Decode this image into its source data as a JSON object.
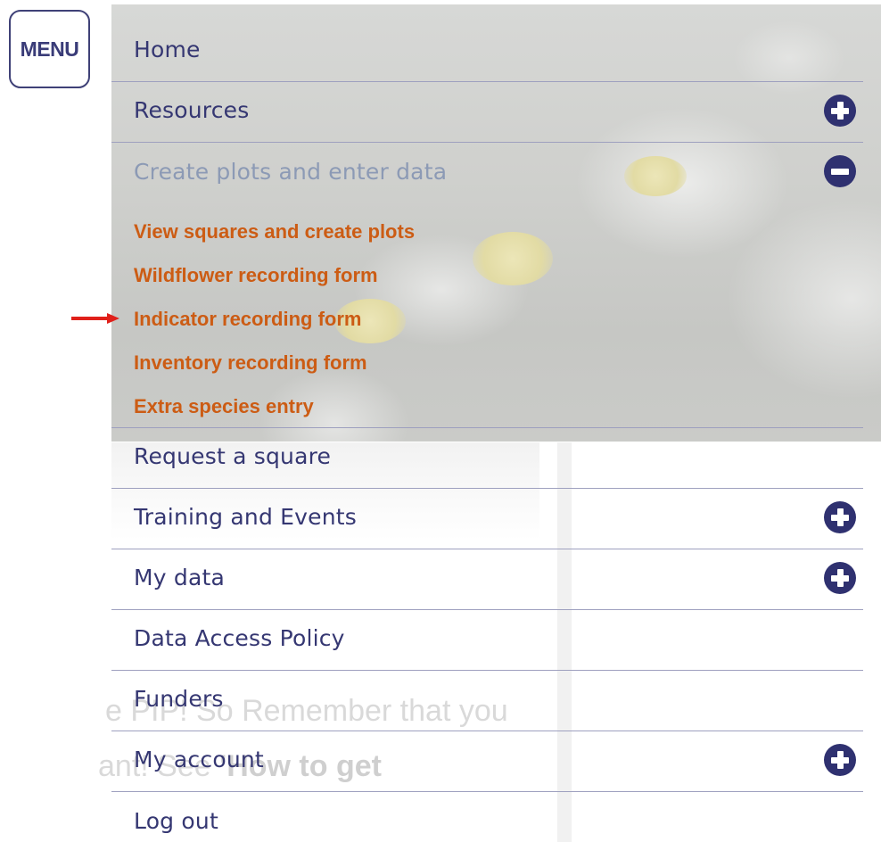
{
  "menu_button": {
    "label": "MENU"
  },
  "nav": {
    "items": [
      {
        "label": "Home",
        "toggle": "none"
      },
      {
        "label": "Resources",
        "toggle": "plus-circle-icon"
      },
      {
        "label": "Create plots and enter data",
        "toggle": "minus-circle-icon",
        "expanded": true
      },
      {
        "label": "Request a square",
        "toggle": "none"
      },
      {
        "label": "Training and Events",
        "toggle": "plus-circle-icon"
      },
      {
        "label": "My data",
        "toggle": "plus-circle-icon"
      },
      {
        "label": "Data Access Policy",
        "toggle": "none"
      },
      {
        "label": "Funders",
        "toggle": "none"
      },
      {
        "label": "My account",
        "toggle": "plus-circle-icon"
      },
      {
        "label": "Log out",
        "toggle": "none"
      }
    ],
    "submenu": [
      {
        "label": "View squares and create plots"
      },
      {
        "label": "Wildflower recording form"
      },
      {
        "label": "Indicator recording form"
      },
      {
        "label": "Inventory recording form"
      },
      {
        "label": "Extra species entry"
      }
    ]
  },
  "background_text": {
    "line1": "e PIP! So Remember that you",
    "line2_prefix": "ant! See ",
    "line2_bold": "'How to get"
  },
  "annotation": {
    "icon": "red-arrow-icon",
    "color": "#e0201a",
    "points_to": "Indicator recording form"
  },
  "colors": {
    "menu_text": "#353772",
    "active_parent": "#8c9ab5",
    "submenu_text": "#cc5c14",
    "toggle_fill": "#2f3170",
    "divider": "#9ea0bf"
  }
}
